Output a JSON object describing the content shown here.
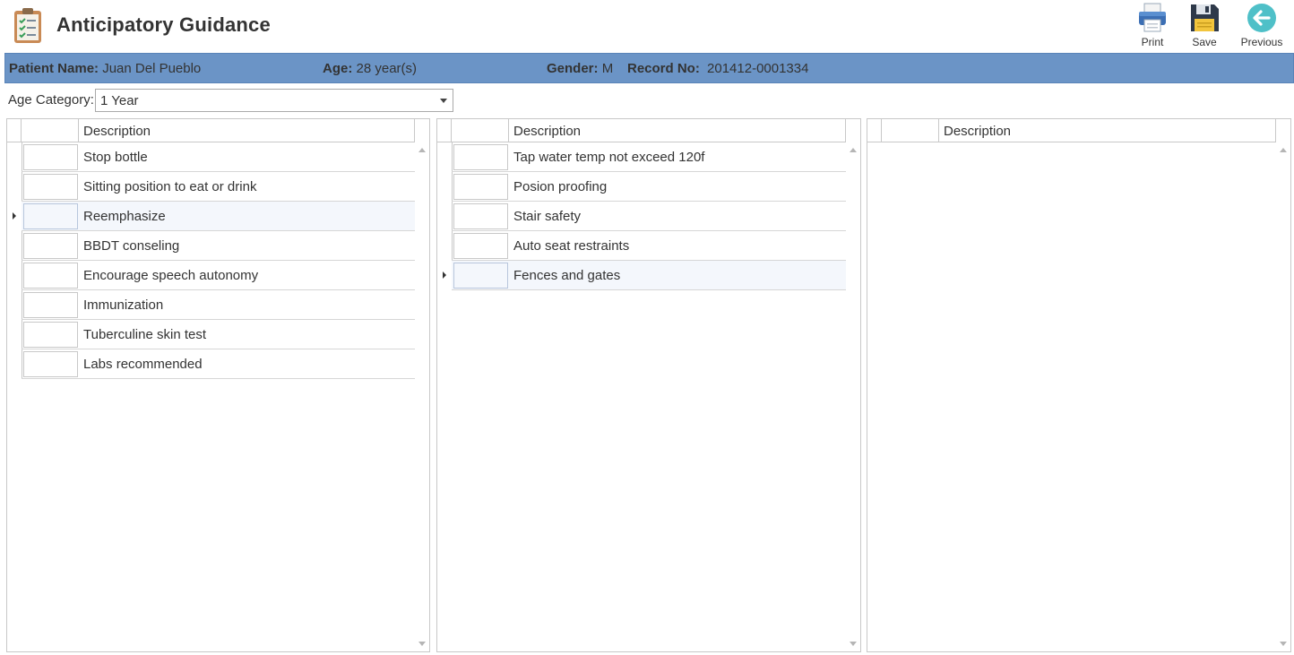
{
  "header": {
    "title": "Anticipatory Guidance",
    "app_icon": "clipboard-checklist-icon",
    "buttons": [
      {
        "label": "Print",
        "icon": "printer-icon"
      },
      {
        "label": "Save",
        "icon": "floppy-disk-icon"
      },
      {
        "label": "Previous",
        "icon": "arrow-left-circle-icon"
      }
    ]
  },
  "patient": {
    "name_label": "Patient Name:",
    "name_value": "Juan Del Pueblo",
    "age_label": "Age:",
    "age_value": "28 year(s)",
    "gender_label": "Gender:",
    "gender_value": "M",
    "record_label": "Record No:",
    "record_value": "201412-0001334",
    "bar_color": "#6b94c6"
  },
  "age_category": {
    "label": "Age Category:",
    "selected": "1 Year"
  },
  "grids": [
    {
      "header": "Description",
      "selected_index": 2,
      "rows": [
        "Stop bottle",
        "Sitting position to eat or drink",
        "Reemphasize",
        "BBDT conseling",
        "Encourage speech autonomy",
        "Immunization",
        "Tuberculine skin test",
        "Labs recommended"
      ]
    },
    {
      "header": "Description",
      "selected_index": 4,
      "rows": [
        "Tap water temp not exceed 120f",
        "Posion proofing",
        "Stair safety",
        "Auto seat restraints",
        "Fences and gates"
      ]
    },
    {
      "header": "Description",
      "selected_index": -1,
      "rows": []
    }
  ]
}
